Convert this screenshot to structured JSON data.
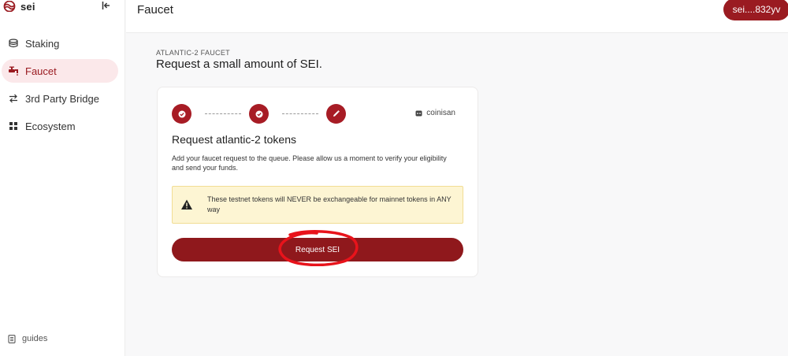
{
  "brand": {
    "name": "sei",
    "logo_icon": "sei-logo-icon",
    "accent": "#9a1b21"
  },
  "sidebar": {
    "collapse_icon": "collapse-left-icon",
    "items": [
      {
        "label": "Staking",
        "icon": "coins-icon",
        "active": false
      },
      {
        "label": "Faucet",
        "icon": "faucet-icon",
        "active": true
      },
      {
        "label": "3rd Party Bridge",
        "icon": "swap-arrows-icon",
        "active": false
      },
      {
        "label": "Ecosystem",
        "icon": "grid-icon",
        "active": false
      }
    ],
    "guides_label": "guides"
  },
  "header": {
    "title": "Faucet",
    "wallet_label": "sei....832yv"
  },
  "main": {
    "eyebrow": "ATLANTIC-2 FAUCET",
    "heading": "Request a small amount of SEI."
  },
  "card": {
    "steps": [
      {
        "icon": "check-icon",
        "state": "done"
      },
      {
        "icon": "check-icon",
        "state": "done"
      },
      {
        "icon": "pencil-icon",
        "state": "current"
      }
    ],
    "user_label": "coinisan",
    "title": "Request atlantic-2 tokens",
    "description": "Add your faucet request to the queue. Please allow us a moment to verify your eligibility and send your funds.",
    "warning": "These testnet tokens will NEVER be exchangeable for mainnet tokens in ANY way",
    "button_label": "Request SEI"
  },
  "colors": {
    "primary": "#9a1b21",
    "button": "#8f181c",
    "warning_bg": "#fdf5d3",
    "active_bg": "#fbe8ea",
    "annotation": "#e8131b"
  }
}
